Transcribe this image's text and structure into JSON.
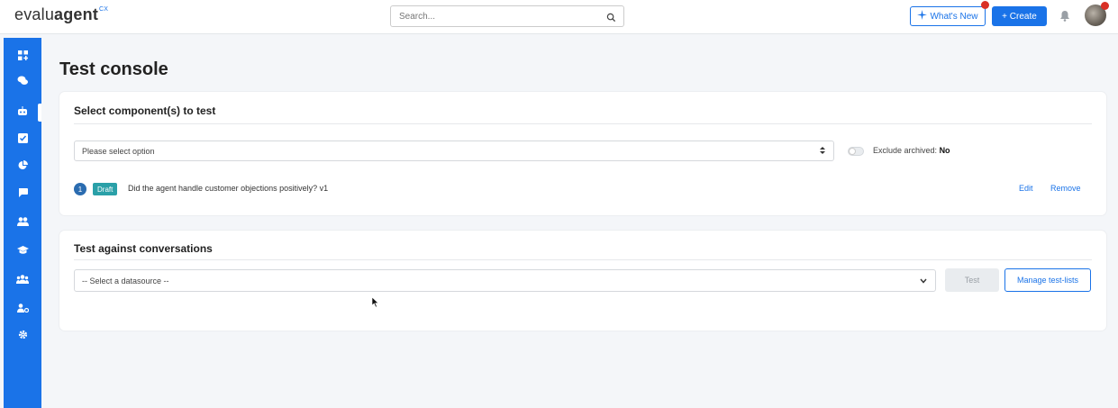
{
  "header": {
    "logo_prefix": "evalu",
    "logo_bold": "agent",
    "logo_sup": "CX",
    "search_placeholder": "Search...",
    "whats_new_label": "What's New",
    "create_label": "+ Create",
    "icons": [
      "search-icon",
      "sparkle-icon",
      "bell-icon"
    ]
  },
  "sidebar": {
    "items": [
      {
        "icon": "dashboard-icon",
        "active": false
      },
      {
        "icon": "chat-icon",
        "active": false
      },
      {
        "icon": "robot-icon",
        "active": true
      },
      {
        "icon": "checkbox-icon",
        "active": false
      },
      {
        "icon": "pie-chart-icon",
        "active": false
      },
      {
        "icon": "message-icon",
        "active": false
      },
      {
        "icon": "users-icon",
        "active": false
      },
      {
        "icon": "graduation-cap-icon",
        "active": false
      },
      {
        "icon": "team-icon",
        "active": false
      },
      {
        "icon": "user-settings-icon",
        "active": false
      },
      {
        "icon": "gear-icon",
        "active": false
      }
    ]
  },
  "main": {
    "title": "Test console",
    "components_section": {
      "title": "Select component(s) to test",
      "select_value": "Please select option",
      "exclude_label": "Exclude archived:",
      "exclude_value": "No",
      "exclude_on": false,
      "items": [
        {
          "number": "1",
          "status": "Draft",
          "text": "Did the agent handle customer objections positively? v1",
          "edit_label": "Edit",
          "remove_label": "Remove"
        }
      ]
    },
    "conversations_section": {
      "title": "Test against conversations",
      "datasource_value": "-- Select a datasource --",
      "test_label": "Test",
      "manage_label": "Manage test-lists"
    }
  },
  "colors": {
    "primary": "#1a73e8",
    "sidebar": "#1a73e8",
    "badge": "#2aa0a8",
    "notification": "#d93025"
  }
}
